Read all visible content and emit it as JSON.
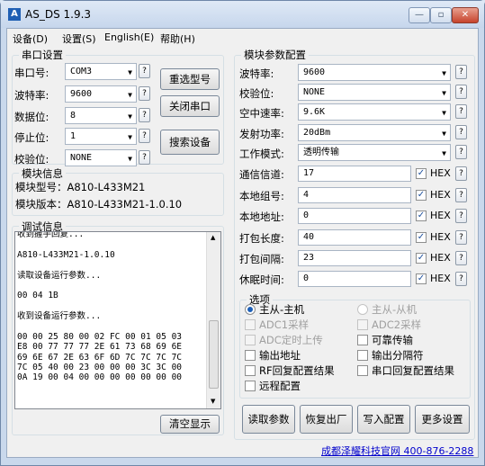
{
  "window": {
    "title": "AS_DS 1.9.3",
    "app_icon": "A",
    "minimize": "—",
    "maximize": "▫",
    "close": "✕"
  },
  "menu": {
    "device": "设备(D)",
    "settings": "设置(S)",
    "english": "English(E)",
    "help": "帮助(H)"
  },
  "serial": {
    "group_title": "串口设置",
    "port_label": "串口号:",
    "port_value": "COM3",
    "baud_label": "波特率:",
    "baud_value": "9600",
    "databits_label": "数据位:",
    "databits_value": "8",
    "stopbits_label": "停止位:",
    "stopbits_value": "1",
    "parity_label": "校验位:",
    "parity_value": "NONE",
    "help": "?",
    "reselect_button": "重选型号",
    "close_port_button": "关闭串口",
    "search_button": "搜索设备"
  },
  "module_info": {
    "group_title": "模块信息",
    "model_line": "模块型号：A810-L433M21",
    "version_line": "模块版本：A810-L433M21-1.0.10"
  },
  "debug": {
    "group_title": "调试信息",
    "clear_button": "清空显示",
    "lines": [
      "收到握手回复...",
      "",
      "A810-L433M21-1.0.10",
      "",
      "读取设备运行参数...",
      "",
      "00 04 1B",
      "",
      "收到设备运行参数...",
      "",
      "00 00 25 80 00 02 FC 00 01 05 03",
      "E8 00 77 77 77 2E 61 73 68 69 6E",
      "69 6E 67 2E 63 6F 6D 7C 7C 7C 7C",
      "7C 05 40 00 23 00 00 00 3C 3C 00",
      "0A 19 00 04 00 00 00 00 00 00 00"
    ]
  },
  "params": {
    "group_title": "模块参数配置",
    "help": "?",
    "selects": [
      {
        "label": "波特率:",
        "value": "9600"
      },
      {
        "label": "校验位:",
        "value": "NONE"
      },
      {
        "label": "空中速率:",
        "value": "9.6K"
      },
      {
        "label": "发射功率:",
        "value": "20dBm"
      },
      {
        "label": "工作模式:",
        "value": "透明传输"
      }
    ],
    "inputs": [
      {
        "label": "通信信道:",
        "value": "17",
        "hex": "HEX"
      },
      {
        "label": "本地组号:",
        "value": "4",
        "hex": "HEX"
      },
      {
        "label": "本地地址:",
        "value": "0",
        "hex": "HEX"
      },
      {
        "label": "打包长度:",
        "value": "40",
        "hex": "HEX"
      },
      {
        "label": "打包间隔:",
        "value": "23",
        "hex": "HEX"
      },
      {
        "label": "休眠时间:",
        "value": "0",
        "hex": "HEX"
      }
    ],
    "options_title": "选项",
    "radio_master": "主从-主机",
    "radio_slave": "主从-从机",
    "adc1": "ADC1采样",
    "adc2": "ADC2采样",
    "adc_timer": "ADC定时上传",
    "reliable": "可靠传输",
    "output_addr": "输出地址",
    "output_sep": "输出分隔符",
    "rf_reply": "RF回复配置结果",
    "serial_reply": "串口回复配置结果",
    "remote": "远程配置",
    "read_button": "读取参数",
    "factory_button": "恢复出厂",
    "write_button": "写入配置",
    "more_button": "更多设置"
  },
  "footer": {
    "link": "成都泽耀科技官网 400-876-2288"
  }
}
